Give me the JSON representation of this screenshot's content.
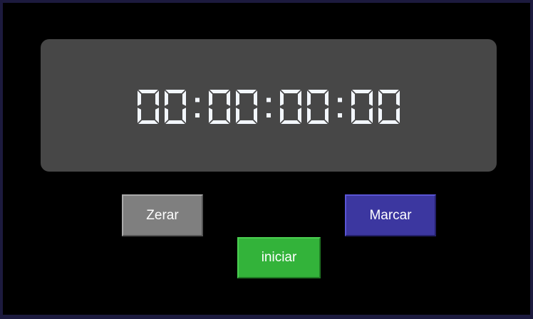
{
  "stopwatch": {
    "display": "00:00:00:00",
    "digit_color": "#f2f6fc"
  },
  "buttons": {
    "reset_label": "Zerar",
    "lap_label": "Marcar",
    "start_label": "iniciar"
  },
  "colors": {
    "background": "#000000",
    "frame": "#1c1a3e",
    "display_panel": "#474747",
    "reset": "#7f7f7f",
    "lap": "#3c37a0",
    "start": "#33b33a"
  }
}
